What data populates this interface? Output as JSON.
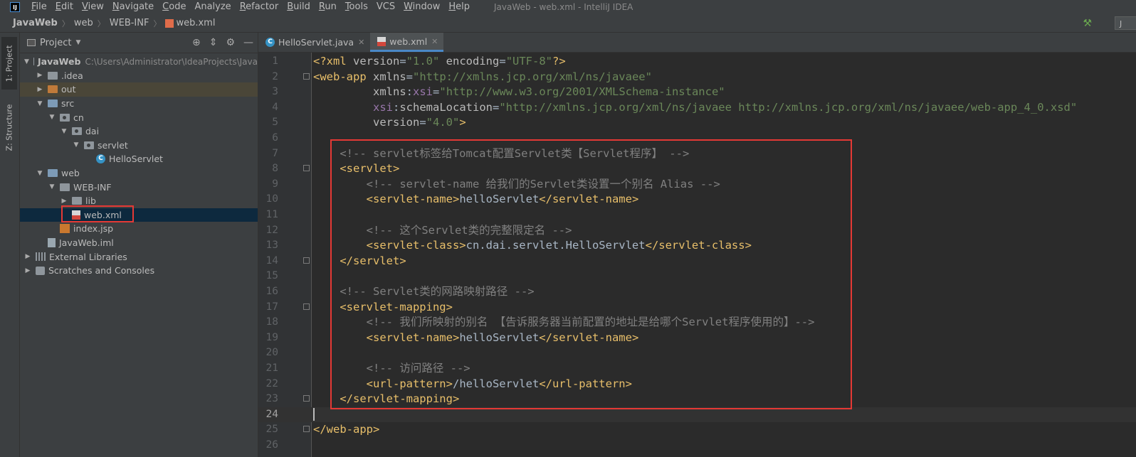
{
  "menubar": {
    "logo": "IJ",
    "items": [
      {
        "ul": "F",
        "rest": "ile"
      },
      {
        "ul": "E",
        "rest": "dit"
      },
      {
        "ul": "V",
        "rest": "iew"
      },
      {
        "ul": "N",
        "rest": "avigate"
      },
      {
        "ul": "C",
        "rest": "ode"
      },
      {
        "ul": "",
        "rest": "Analyze"
      },
      {
        "ul": "R",
        "rest": "efactor"
      },
      {
        "ul": "B",
        "rest": "uild"
      },
      {
        "ul": "R",
        "rest": "un"
      },
      {
        "ul": "T",
        "rest": "ools"
      },
      {
        "ul": "",
        "rest": "VCS"
      },
      {
        "ul": "W",
        "rest": "indow"
      },
      {
        "ul": "H",
        "rest": "elp"
      }
    ],
    "window_title": "JavaWeb - web.xml - IntelliJ IDEA"
  },
  "breadcrumb": {
    "items": [
      "JavaWeb",
      "web",
      "WEB-INF",
      "web.xml"
    ],
    "run_config": "J"
  },
  "tool_strip": {
    "project_tab": "1: Project",
    "structure_tab": "Z: Structure"
  },
  "project_panel": {
    "title": "Project",
    "tree": [
      {
        "label": "JavaWeb",
        "hint": "C:\\Users\\Administrator\\IdeaProjects\\Java",
        "depth": 0,
        "arrow": "down",
        "icon": "folder-grey",
        "bold": true
      },
      {
        "label": ".idea",
        "depth": 1,
        "arrow": "right",
        "icon": "folder-grey"
      },
      {
        "label": "out",
        "depth": 1,
        "arrow": "right",
        "icon": "folder-orange",
        "highlight": true
      },
      {
        "label": "src",
        "depth": 1,
        "arrow": "down",
        "icon": "folder-blue"
      },
      {
        "label": "cn",
        "depth": 2,
        "arrow": "down",
        "icon": "package"
      },
      {
        "label": "dai",
        "depth": 3,
        "arrow": "down",
        "icon": "package"
      },
      {
        "label": "servlet",
        "depth": 4,
        "arrow": "down",
        "icon": "package"
      },
      {
        "label": "HelloServlet",
        "depth": 5,
        "arrow": "none",
        "icon": "class"
      },
      {
        "label": "web",
        "depth": 1,
        "arrow": "down",
        "icon": "folder-blue-web"
      },
      {
        "label": "WEB-INF",
        "depth": 2,
        "arrow": "down",
        "icon": "folder-grey"
      },
      {
        "label": "lib",
        "depth": 3,
        "arrow": "right",
        "icon": "folder-grey"
      },
      {
        "label": "web.xml",
        "depth": 3,
        "arrow": "none",
        "icon": "xml",
        "selected": true
      },
      {
        "label": "index.jsp",
        "depth": 2,
        "arrow": "none",
        "icon": "jsp"
      },
      {
        "label": "JavaWeb.iml",
        "depth": 1,
        "arrow": "none",
        "icon": "iml"
      },
      {
        "label": "External Libraries",
        "depth": 0,
        "arrow": "right",
        "icon": "libraries"
      },
      {
        "label": "Scratches and Consoles",
        "depth": 0,
        "arrow": "right",
        "icon": "scratches"
      }
    ]
  },
  "editor": {
    "tabs": [
      {
        "label": "HelloServlet.java",
        "icon": "class",
        "active": false
      },
      {
        "label": "web.xml",
        "icon": "xml",
        "active": true
      }
    ],
    "current_line": 24,
    "lines": [
      {
        "n": "1",
        "segs": [
          [
            "pi",
            "<?xml "
          ],
          [
            "attr",
            "version"
          ],
          [
            "plain",
            "="
          ],
          [
            "val",
            "\"1.0\""
          ],
          [
            "attr",
            " encoding"
          ],
          [
            "plain",
            "="
          ],
          [
            "val",
            "\"UTF-8\""
          ],
          [
            "pi",
            "?>"
          ]
        ]
      },
      {
        "n": "2",
        "fold": true,
        "segs": [
          [
            "tag",
            "<web-app "
          ],
          [
            "attr",
            "xmlns"
          ],
          [
            "plain",
            "="
          ],
          [
            "val",
            "\"http://xmlns.jcp.org/xml/ns/javaee\""
          ]
        ]
      },
      {
        "n": "3",
        "segs": [
          [
            "plain",
            "         "
          ],
          [
            "attr",
            "xmlns"
          ],
          [
            "plain",
            ":"
          ],
          [
            "ns",
            "xsi"
          ],
          [
            "plain",
            "="
          ],
          [
            "val",
            "\"http://www.w3.org/2001/XMLSchema-instance\""
          ]
        ]
      },
      {
        "n": "4",
        "segs": [
          [
            "plain",
            "         "
          ],
          [
            "ns",
            "xsi"
          ],
          [
            "plain",
            ":"
          ],
          [
            "attr",
            "schemaLocation"
          ],
          [
            "plain",
            "="
          ],
          [
            "val",
            "\"http://xmlns.jcp.org/xml/ns/javaee http://xmlns.jcp.org/xml/ns/javaee/web-app_4_0.xsd\""
          ]
        ]
      },
      {
        "n": "5",
        "segs": [
          [
            "plain",
            "         "
          ],
          [
            "attr",
            "version"
          ],
          [
            "plain",
            "="
          ],
          [
            "val",
            "\"4.0\""
          ],
          [
            "tag",
            ">"
          ]
        ]
      },
      {
        "n": "6",
        "segs": []
      },
      {
        "n": "7",
        "segs": [
          [
            "plain",
            "    "
          ],
          [
            "com",
            "<!-- servlet标签给Tomcat配置Servlet类【Servlet程序】 -->"
          ]
        ]
      },
      {
        "n": "8",
        "fold": true,
        "segs": [
          [
            "plain",
            "    "
          ],
          [
            "tag",
            "<servlet>"
          ]
        ]
      },
      {
        "n": "9",
        "segs": [
          [
            "plain",
            "        "
          ],
          [
            "com",
            "<!-- servlet-name 给我们的Servlet类设置一个别名 Alias -->"
          ]
        ]
      },
      {
        "n": "10",
        "segs": [
          [
            "plain",
            "        "
          ],
          [
            "tag",
            "<servlet-name>"
          ],
          [
            "plain",
            "helloServlet"
          ],
          [
            "tag",
            "</servlet-name>"
          ]
        ]
      },
      {
        "n": "11",
        "segs": []
      },
      {
        "n": "12",
        "segs": [
          [
            "plain",
            "        "
          ],
          [
            "com",
            "<!-- 这个Servlet类的完整限定名 -->"
          ]
        ]
      },
      {
        "n": "13",
        "segs": [
          [
            "plain",
            "        "
          ],
          [
            "tag",
            "<servlet-class>"
          ],
          [
            "plain",
            "cn.dai.servlet.HelloServlet"
          ],
          [
            "tag",
            "</servlet-class>"
          ]
        ]
      },
      {
        "n": "14",
        "fold": true,
        "segs": [
          [
            "plain",
            "    "
          ],
          [
            "tag",
            "</servlet>"
          ]
        ]
      },
      {
        "n": "15",
        "segs": []
      },
      {
        "n": "16",
        "segs": [
          [
            "plain",
            "    "
          ],
          [
            "com",
            "<!-- Servlet类的网路映射路径 -->"
          ]
        ]
      },
      {
        "n": "17",
        "fold": true,
        "segs": [
          [
            "plain",
            "    "
          ],
          [
            "tag",
            "<servlet-mapping>"
          ]
        ]
      },
      {
        "n": "18",
        "segs": [
          [
            "plain",
            "        "
          ],
          [
            "com",
            "<!-- 我们所映射的别名 【告诉服务器当前配置的地址是给哪个Servlet程序使用的】-->"
          ]
        ]
      },
      {
        "n": "19",
        "segs": [
          [
            "plain",
            "        "
          ],
          [
            "tag",
            "<servlet-name>"
          ],
          [
            "plain",
            "helloServlet"
          ],
          [
            "tag",
            "</servlet-name>"
          ]
        ]
      },
      {
        "n": "20",
        "segs": []
      },
      {
        "n": "21",
        "segs": [
          [
            "plain",
            "        "
          ],
          [
            "com",
            "<!-- 访问路径 -->"
          ]
        ]
      },
      {
        "n": "22",
        "segs": [
          [
            "plain",
            "        "
          ],
          [
            "tag",
            "<url-pattern>"
          ],
          [
            "plain",
            "/helloServlet"
          ],
          [
            "tag",
            "</url-pattern>"
          ]
        ]
      },
      {
        "n": "23",
        "fold": true,
        "segs": [
          [
            "plain",
            "    "
          ],
          [
            "tag",
            "</servlet-mapping>"
          ]
        ]
      },
      {
        "n": "24",
        "caret": true,
        "segs": []
      },
      {
        "n": "25",
        "fold": true,
        "segs": [
          [
            "tag",
            "</web-app>"
          ]
        ]
      },
      {
        "n": "26",
        "segs": []
      }
    ]
  },
  "colors": {
    "highlight_box": "#e53935",
    "xml_tag": "#e8bf6a",
    "xml_value": "#6a8759",
    "xml_comment": "#808080",
    "xml_namespace": "#9876aa",
    "selection": "#0d293e"
  }
}
